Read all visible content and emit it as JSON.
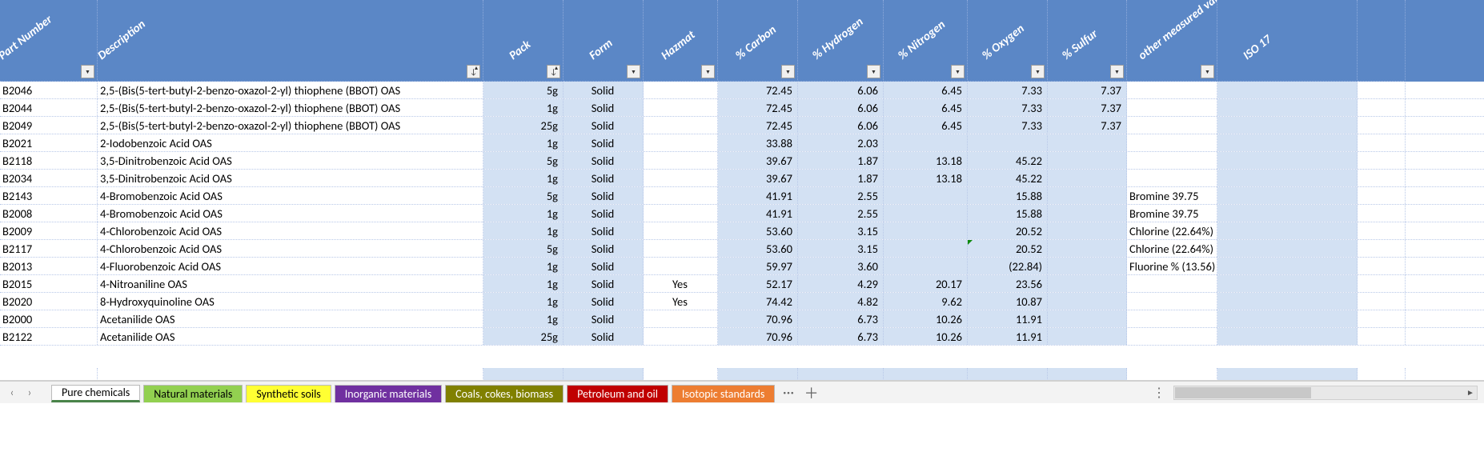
{
  "columns": [
    {
      "key": "part",
      "label": "Part Number",
      "sorted": false
    },
    {
      "key": "desc",
      "label": "Description",
      "sorted": true
    },
    {
      "key": "pack",
      "label": "Pack",
      "sorted": true
    },
    {
      "key": "form",
      "label": "Form",
      "sorted": false
    },
    {
      "key": "hazmat",
      "label": "Hazmat",
      "sorted": false
    },
    {
      "key": "carbon",
      "label": "% Carbon",
      "sorted": false
    },
    {
      "key": "hydrogen",
      "label": "% Hydrogen",
      "sorted": false
    },
    {
      "key": "nitrogen",
      "label": "% Nitrogen",
      "sorted": false
    },
    {
      "key": "oxygen",
      "label": "% Oxygen",
      "sorted": false
    },
    {
      "key": "sulfur",
      "label": "% Sulfur",
      "sorted": false
    },
    {
      "key": "other",
      "label": "other measured values",
      "sorted": false
    },
    {
      "key": "iso",
      "label": "ISO 17",
      "sorted": false
    }
  ],
  "rows": [
    {
      "part": "B2046",
      "desc": "2,5-(Bis(5-tert-butyl-2-benzo-oxazol-2-yl) thiophene (BBOT) OAS",
      "pack": "5g",
      "form": "Solid",
      "hazmat": "",
      "carbon": "72.45",
      "hydrogen": "6.06",
      "nitrogen": "6.45",
      "oxygen": "7.33",
      "sulfur": "7.37",
      "other": ""
    },
    {
      "part": "B2044",
      "desc": "2,5-(Bis(5-tert-butyl-2-benzo-oxazol-2-yl) thiophene (BBOT) OAS",
      "pack": "1g",
      "form": "Solid",
      "hazmat": "",
      "carbon": "72.45",
      "hydrogen": "6.06",
      "nitrogen": "6.45",
      "oxygen": "7.33",
      "sulfur": "7.37",
      "other": ""
    },
    {
      "part": "B2049",
      "desc": "2,5-(Bis(5-tert-butyl-2-benzo-oxazol-2-yl) thiophene (BBOT) OAS",
      "pack": "25g",
      "form": "Solid",
      "hazmat": "",
      "carbon": "72.45",
      "hydrogen": "6.06",
      "nitrogen": "6.45",
      "oxygen": "7.33",
      "sulfur": "7.37",
      "other": ""
    },
    {
      "part": "B2021",
      "desc": "2-Iodobenzoic Acid OAS",
      "pack": "1g",
      "form": "Solid",
      "hazmat": "",
      "carbon": "33.88",
      "hydrogen": "2.03",
      "nitrogen": "",
      "oxygen": "",
      "sulfur": "",
      "other": ""
    },
    {
      "part": "B2118",
      "desc": "3,5-Dinitrobenzoic Acid OAS",
      "pack": "5g",
      "form": "Solid",
      "hazmat": "",
      "carbon": "39.67",
      "hydrogen": "1.87",
      "nitrogen": "13.18",
      "oxygen": "45.22",
      "sulfur": "",
      "other": ""
    },
    {
      "part": "B2034",
      "desc": "3,5-Dinitrobenzoic Acid OAS",
      "pack": "1g",
      "form": "Solid",
      "hazmat": "",
      "carbon": "39.67",
      "hydrogen": "1.87",
      "nitrogen": "13.18",
      "oxygen": "45.22",
      "sulfur": "",
      "other": ""
    },
    {
      "part": "B2143",
      "desc": "4-Bromobenzoic Acid OAS",
      "pack": "5g",
      "form": "Solid",
      "hazmat": "",
      "carbon": "41.91",
      "hydrogen": "2.55",
      "nitrogen": "",
      "oxygen": "15.88",
      "sulfur": "",
      "other": "Bromine 39.75"
    },
    {
      "part": "B2008",
      "desc": "4-Bromobenzoic Acid OAS",
      "pack": "1g",
      "form": "Solid",
      "hazmat": "",
      "carbon": "41.91",
      "hydrogen": "2.55",
      "nitrogen": "",
      "oxygen": "15.88",
      "sulfur": "",
      "other": "Bromine 39.75"
    },
    {
      "part": "B2009",
      "desc": "4-Chlorobenzoic Acid OAS",
      "pack": "1g",
      "form": "Solid",
      "hazmat": "",
      "carbon": "53.60",
      "hydrogen": "3.15",
      "nitrogen": "",
      "oxygen": "20.52",
      "sulfur": "",
      "other": "Chlorine (22.64%)"
    },
    {
      "part": "B2117",
      "desc": "4-Chlorobenzoic Acid OAS",
      "pack": "5g",
      "form": "Solid",
      "hazmat": "",
      "carbon": "53.60",
      "hydrogen": "3.15",
      "nitrogen": "",
      "oxygen": "20.52",
      "sulfur": "",
      "other": "Chlorine (22.64%)",
      "errOxy": true
    },
    {
      "part": "B2013",
      "desc": "4-Fluorobenzoic Acid OAS",
      "pack": "1g",
      "form": "Solid",
      "hazmat": "",
      "carbon": "59.97",
      "hydrogen": "3.60",
      "nitrogen": "",
      "oxygen": "(22.84)",
      "sulfur": "",
      "other": "Fluorine % (13.56)"
    },
    {
      "part": "B2015",
      "desc": "4-Nitroaniline OAS",
      "pack": "1g",
      "form": "Solid",
      "hazmat": "Yes",
      "carbon": "52.17",
      "hydrogen": "4.29",
      "nitrogen": "20.17",
      "oxygen": "23.56",
      "sulfur": "",
      "other": ""
    },
    {
      "part": "B2020",
      "desc": "8-Hydroxyquinoline OAS",
      "pack": "1g",
      "form": "Solid",
      "hazmat": "Yes",
      "carbon": "74.42",
      "hydrogen": "4.82",
      "nitrogen": "9.62",
      "oxygen": "10.87",
      "sulfur": "",
      "other": ""
    },
    {
      "part": "B2000",
      "desc": "Acetanilide OAS",
      "pack": "1g",
      "form": "Solid",
      "hazmat": "",
      "carbon": "70.96",
      "hydrogen": "6.73",
      "nitrogen": "10.26",
      "oxygen": "11.91",
      "sulfur": "",
      "other": ""
    },
    {
      "part": "B2122",
      "desc": "Acetanilide OAS",
      "pack": "25g",
      "form": "Solid",
      "hazmat": "",
      "carbon": "70.96",
      "hydrogen": "6.73",
      "nitrogen": "10.26",
      "oxygen": "11.91",
      "sulfur": "",
      "other": ""
    }
  ],
  "tabs": [
    {
      "label": "Pure chemicals",
      "bg": "#ffffff",
      "fg": "#000",
      "active": true,
      "accent": "#4a844a"
    },
    {
      "label": "Natural materials",
      "bg": "#92d050",
      "fg": "#000"
    },
    {
      "label": "Synthetic soils",
      "bg": "#ffff33",
      "fg": "#000"
    },
    {
      "label": "Inorganic materials",
      "bg": "#7030a0",
      "fg": "#fff"
    },
    {
      "label": "Coals, cokes, biomass",
      "bg": "#808000",
      "fg": "#fff"
    },
    {
      "label": "Petroleum and oil",
      "bg": "#c00000",
      "fg": "#fff"
    },
    {
      "label": "Isotopic standards",
      "bg": "#ed7d31",
      "fg": "#fff"
    }
  ],
  "icons": {
    "dropdown": "▼",
    "more": "···",
    "plus": "＋",
    "options": "⋮",
    "left": "◄",
    "right": "►",
    "nav_prev": "‹",
    "nav_next": "›"
  }
}
